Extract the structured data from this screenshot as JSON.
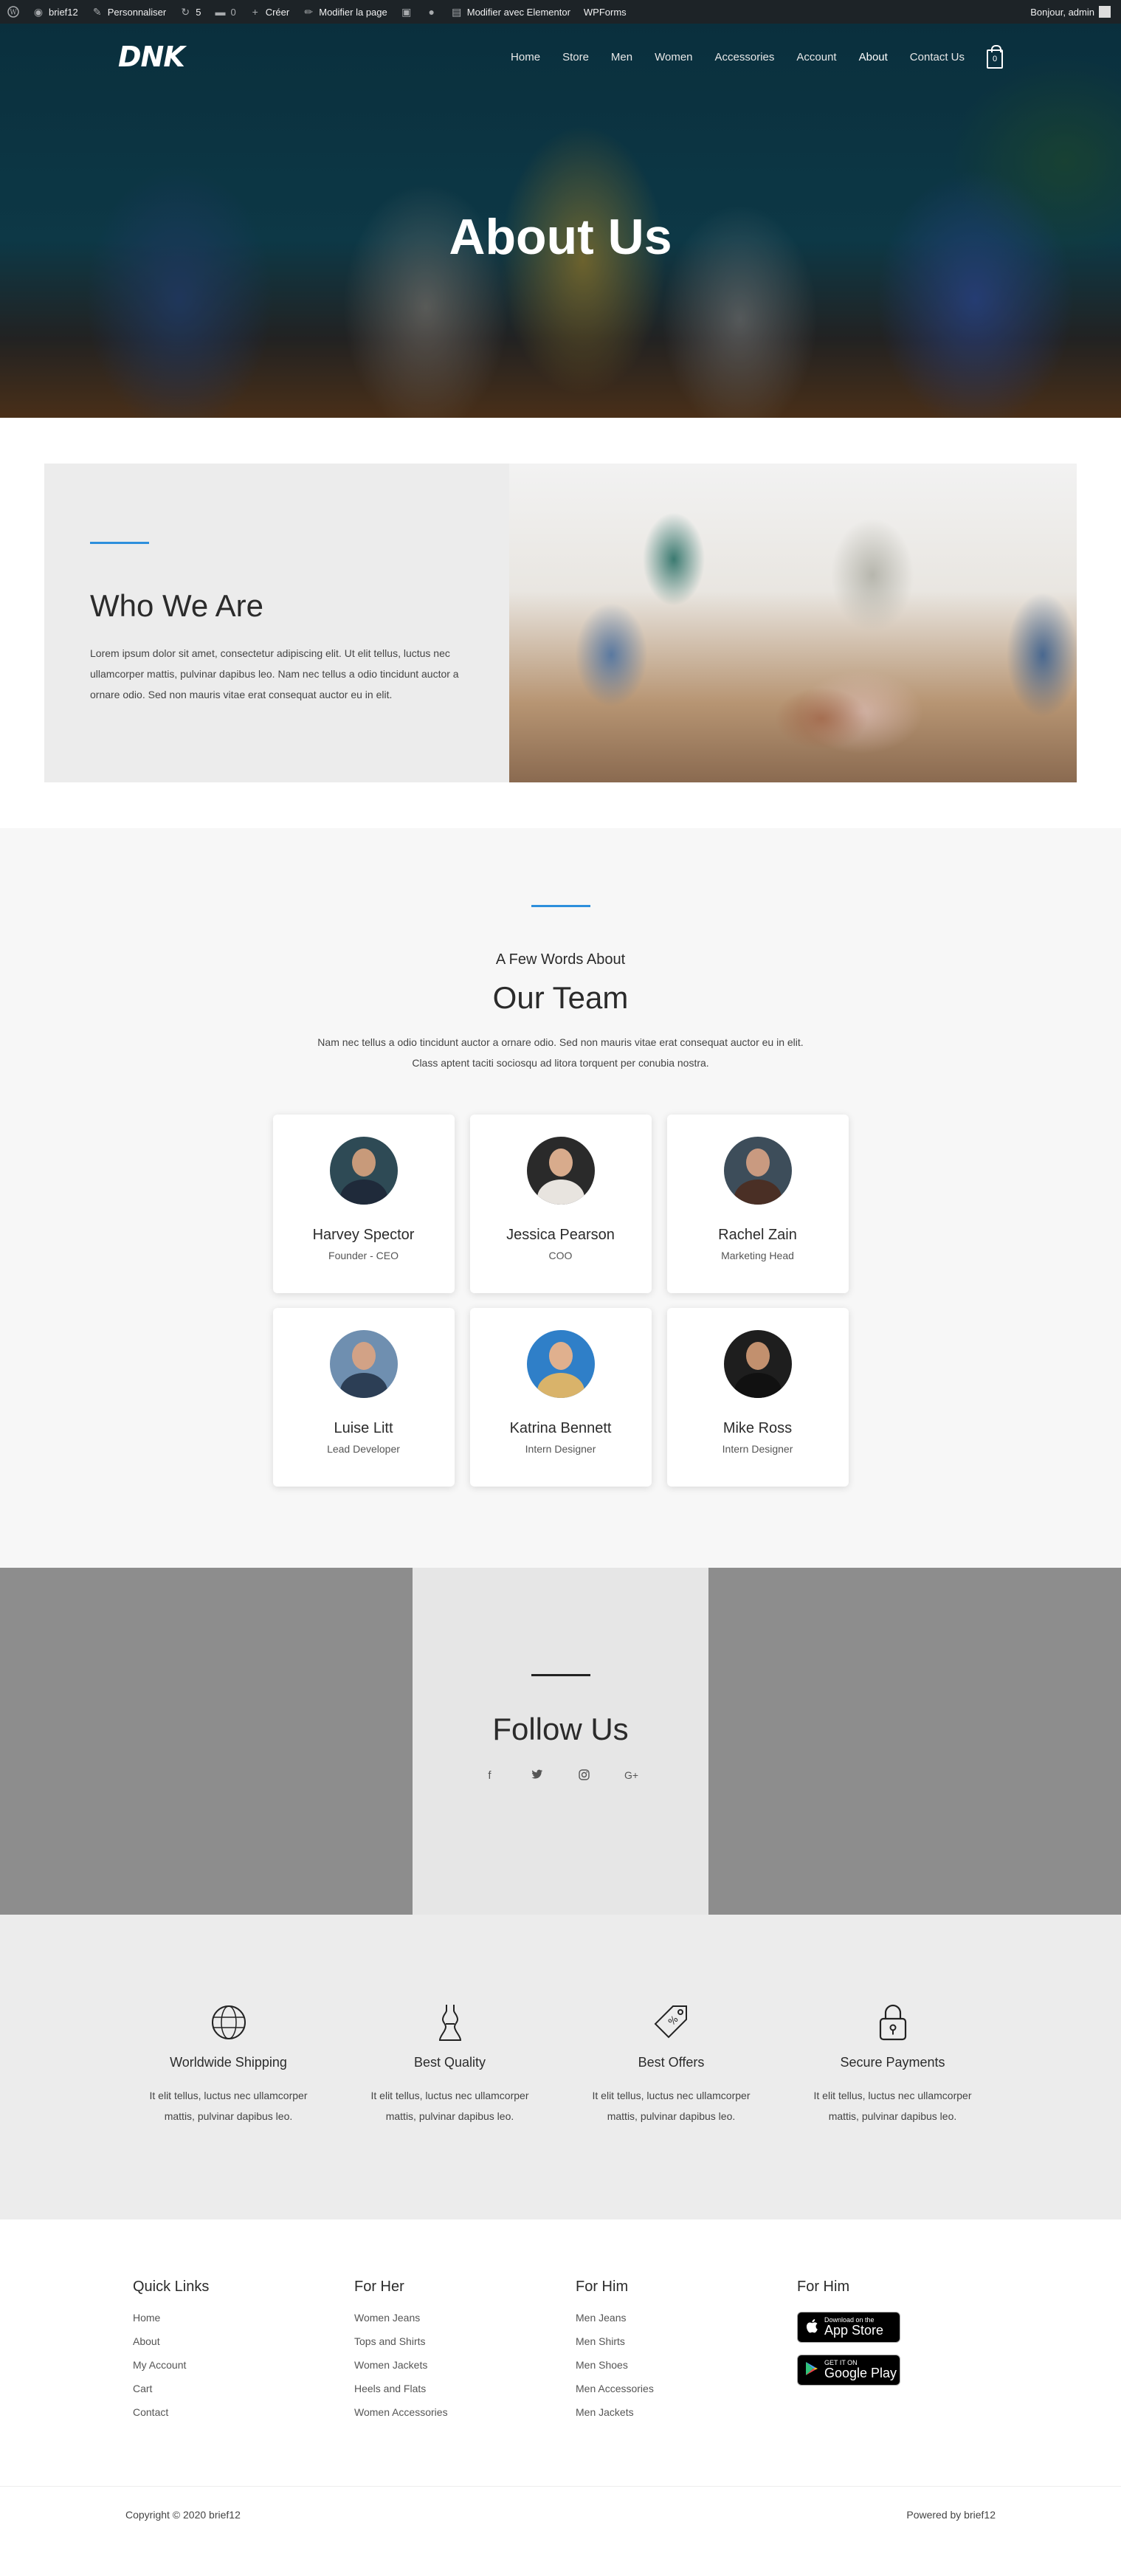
{
  "adminbar": {
    "items": [
      {
        "icon": "wordpress-icon",
        "label": ""
      },
      {
        "icon": "dashboard-icon",
        "label": "brief12"
      },
      {
        "icon": "brush-icon",
        "label": "Personnaliser"
      },
      {
        "icon": "updates-icon",
        "label": "5"
      },
      {
        "icon": "comment-icon",
        "label": "0"
      },
      {
        "icon": "plus-icon",
        "label": "Créer"
      },
      {
        "icon": "pencil-icon",
        "label": "Modifier la page"
      },
      {
        "icon": "plugin-icon",
        "label": ""
      },
      {
        "icon": "dot-icon",
        "label": ""
      },
      {
        "icon": "elementor-icon",
        "label": "Modifier avec Elementor"
      },
      {
        "icon": "",
        "label": "WPForms"
      }
    ],
    "greeting": "Bonjour, admin"
  },
  "header": {
    "logo": "DNK",
    "nav": [
      "Home",
      "Store",
      "Men",
      "Women",
      "Accessories",
      "Account",
      "About",
      "Contact Us"
    ],
    "active_nav": "About",
    "cart_count": "0"
  },
  "hero": {
    "title": "About Us"
  },
  "who": {
    "title": "Who We Are",
    "body": "Lorem ipsum dolor sit amet, consectetur adipiscing elit. Ut elit tellus, luctus nec ullamcorper mattis, pulvinar dapibus leo. Nam nec tellus a odio tincidunt auctor a ornare odio. Sed non mauris vitae erat consequat auctor eu in elit."
  },
  "team": {
    "subtitle": "A Few Words About",
    "title": "Our Team",
    "desc_line1": "Nam nec tellus a odio tincidunt auctor a ornare odio. Sed non mauris vitae erat consequat auctor eu in elit.",
    "desc_line2": "Class aptent taciti sociosqu ad litora torquent per conubia nostra.",
    "members": [
      {
        "name": "Harvey Spector",
        "role": "Founder - CEO"
      },
      {
        "name": "Jessica Pearson",
        "role": "COO"
      },
      {
        "name": "Rachel Zain",
        "role": "Marketing Head"
      },
      {
        "name": "Luise Litt",
        "role": "Lead Developer"
      },
      {
        "name": "Katrina Bennett",
        "role": "Intern Designer"
      },
      {
        "name": "Mike Ross",
        "role": "Intern Designer"
      }
    ]
  },
  "follow": {
    "title": "Follow Us",
    "social": [
      "facebook-icon",
      "twitter-icon",
      "instagram-icon",
      "google-plus-icon"
    ]
  },
  "features": [
    {
      "icon": "globe-icon",
      "title": "Worldwide Shipping",
      "body": "It elit tellus, luctus nec ullamcorper mattis, pulvinar dapibus leo."
    },
    {
      "icon": "dress-icon",
      "title": "Best Quality",
      "body": "It elit tellus, luctus nec ullamcorper mattis, pulvinar dapibus leo."
    },
    {
      "icon": "tag-icon",
      "title": "Best Offers",
      "body": "It elit tellus, luctus nec ullamcorper mattis, pulvinar dapibus leo."
    },
    {
      "icon": "lock-icon",
      "title": "Secure Payments",
      "body": "It elit tellus, luctus nec ullamcorper mattis, pulvinar dapibus leo."
    }
  ],
  "footer": {
    "quick_links": {
      "title": "Quick Links",
      "links": [
        "Home",
        "About",
        "My Account",
        "Cart",
        "Contact"
      ]
    },
    "for_her": {
      "title": "For Her",
      "links": [
        "Women Jeans",
        "Tops and Shirts",
        "Women Jackets",
        "Heels and Flats",
        "Women Accessories"
      ]
    },
    "for_him": {
      "title": "For Him",
      "links": [
        "Men Jeans",
        "Men Shirts",
        "Men Shoes",
        "Men Accessories",
        "Men Jackets"
      ]
    },
    "apps": {
      "title": "For Him",
      "app_store_small": "Download on the",
      "app_store_big": "App Store",
      "google_small": "GET IT ON",
      "google_big": "Google Play"
    },
    "copyright": "Copyright © 2020 brief12",
    "powered": "Powered by brief12"
  },
  "colors": {
    "accent": "#2d8fdc",
    "adminbar": "#1d2327",
    "section_gray": "#ececec",
    "follow_side": "#8d8d8d"
  }
}
